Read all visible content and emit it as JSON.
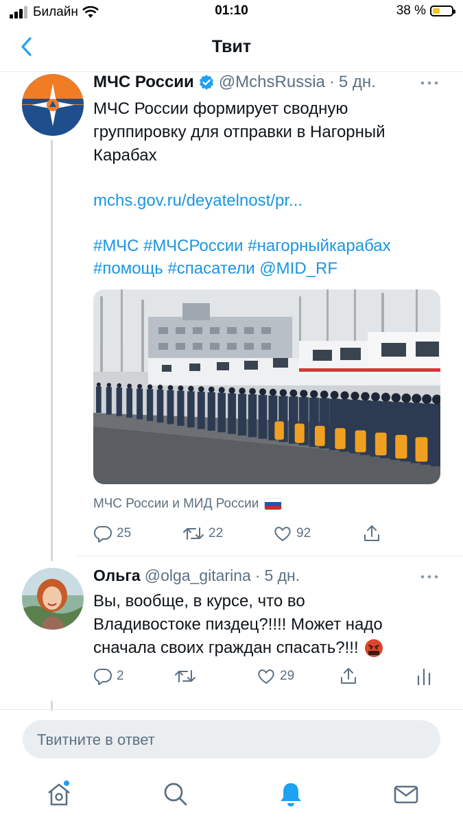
{
  "status_bar": {
    "carrier": "Билайн",
    "time": "01:10",
    "battery": "38 %",
    "battery_level": 0.38
  },
  "nav": {
    "title": "Твит"
  },
  "tweet": {
    "author_name": "МЧС России",
    "handle": "@MchsRussia",
    "dot": "·",
    "age": "5 дн.",
    "text_lines": [
      "МЧС России формирует сводную",
      "группировку для отправки в Нагорный",
      "Карабах"
    ],
    "link": "mchs.gov.ru/deyatelnost/pr...",
    "hashtags_line1": "#МЧС #МЧСРоссии #нагорныйкарабах",
    "hashtags_line2": "#помощь #спасатели @MID_RF",
    "caption": "МЧС России и МИД России",
    "stats": {
      "replies": "25",
      "retweets": "22",
      "likes": "92"
    }
  },
  "reply": {
    "author_name": "Ольга",
    "handle": "@olga_gitarina",
    "dot": "·",
    "age": "5 дн.",
    "text_lines": [
      "Вы, вообще, в курсе, что во",
      "Владивостоке пиздец?!!!! Может надо",
      "сначала своих граждан спасать?!!!"
    ],
    "stats": {
      "replies": "2",
      "likes": "29"
    }
  },
  "composer": {
    "placeholder": "Твитните в ответ"
  },
  "colors": {
    "accent": "#1da1f2",
    "link": "#1b95e0",
    "muted": "#5b7083"
  },
  "icons": [
    "back-chevron-icon",
    "verified-badge-icon",
    "more-icon",
    "reply-icon",
    "retweet-icon",
    "like-icon",
    "share-icon",
    "analytics-icon",
    "home-icon",
    "search-icon",
    "notifications-icon",
    "messages-icon"
  ]
}
